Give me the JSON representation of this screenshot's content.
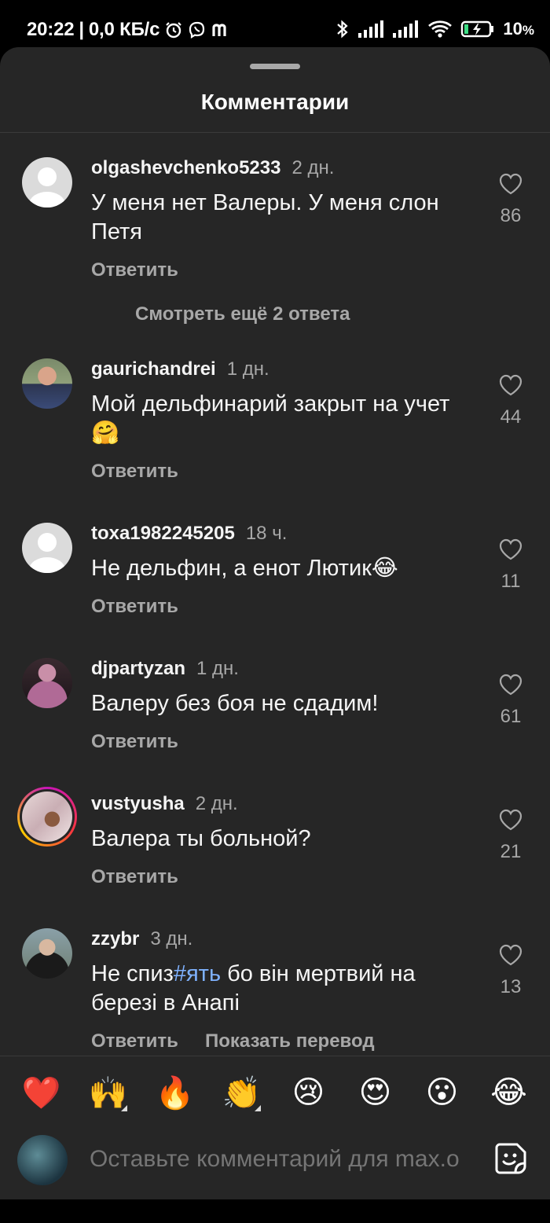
{
  "status": {
    "time": "20:22",
    "separator": "|",
    "speed": "0,0 КБ/с",
    "battery": "10",
    "battery_unit": "%"
  },
  "sheet": {
    "title": "Комментарии"
  },
  "comments": [
    {
      "username": "olgashevchenko5233",
      "time": "2 дн.",
      "text": "У меня нет Валеры. У меня слон Петя",
      "reply": "Ответить",
      "likes": "86"
    },
    {
      "username": "gaurichandrei",
      "time": "1 дн.",
      "text": "Мой дельфинарий  закрыт на учет 🤗",
      "reply": "Ответить",
      "likes": "44"
    },
    {
      "username": "toxa1982245205",
      "time": "18 ч.",
      "text": "Не дельфин, а енот Лютик😂",
      "reply": "Ответить",
      "likes": "11"
    },
    {
      "username": "djpartyzan",
      "time": "1 дн.",
      "text": "Валеру без боя не сдадим!",
      "reply": "Ответить",
      "likes": "61"
    },
    {
      "username": "vustyusha",
      "time": "2 дн.",
      "text": "Валера ты больной?",
      "reply": "Ответить",
      "likes": "21"
    },
    {
      "username": "zzybr",
      "time": "3 дн.",
      "text_before": "Не спиз",
      "text_hashtag": "#ять",
      "text_after": " бо він мертвий на березі в Анапі",
      "reply": "Ответить",
      "translate": "Показать перевод",
      "likes": "13"
    }
  ],
  "view_more": "Смотреть ещё 2 ответа",
  "emojis": [
    "❤️",
    "🙌",
    "🔥",
    "👏",
    "😢",
    "😍",
    "😮",
    "😂"
  ],
  "composer": {
    "placeholder": "Оставьте комментарий для max.o"
  },
  "colors": {
    "sheet_bg": "#262626",
    "secondary_text": "#a8a8a8",
    "hashtag": "#7fb2ff"
  }
}
